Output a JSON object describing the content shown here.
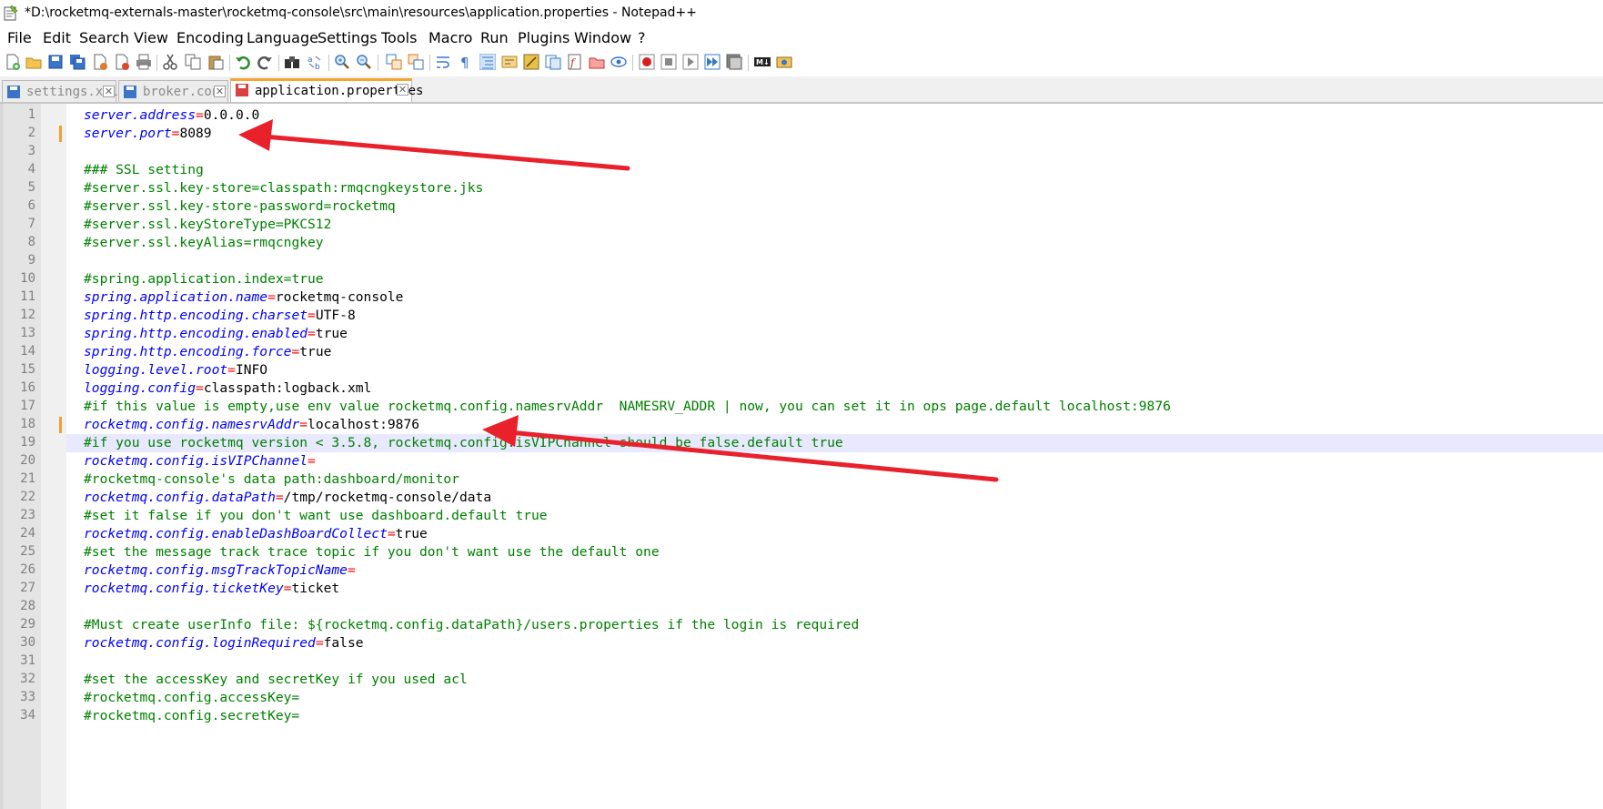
{
  "window": {
    "title": "*D:\\rocketmq-externals-master\\rocketmq-console\\src\\main\\resources\\application.properties - Notepad++"
  },
  "menu": [
    "File",
    "Edit",
    "Search",
    "View",
    "Encoding",
    "Language",
    "Settings",
    "Tools",
    "Macro",
    "Run",
    "Plugins",
    "Window",
    "?"
  ],
  "tabs": [
    {
      "label": "settings.xml",
      "active": false,
      "close": "✕"
    },
    {
      "label": "broker.conf",
      "active": false,
      "close": "✕"
    },
    {
      "label": "application.properties",
      "active": true,
      "close": "✕"
    }
  ],
  "editor": {
    "current_line": 19,
    "changed_lines": [
      2,
      18
    ],
    "lines": [
      {
        "n": "1",
        "type": "prop",
        "key": "server.address",
        "value": "0.0.0.0"
      },
      {
        "n": "2",
        "type": "prop",
        "key": "server.port",
        "value": "8089"
      },
      {
        "n": "3",
        "type": "blank"
      },
      {
        "n": "4",
        "type": "comment",
        "text": "### SSL setting"
      },
      {
        "n": "5",
        "type": "comment",
        "text": "#server.ssl.key-store=classpath:rmqcngkeystore.jks"
      },
      {
        "n": "6",
        "type": "comment",
        "text": "#server.ssl.key-store-password=rocketmq"
      },
      {
        "n": "7",
        "type": "comment",
        "text": "#server.ssl.keyStoreType=PKCS12"
      },
      {
        "n": "8",
        "type": "comment",
        "text": "#server.ssl.keyAlias=rmqcngkey"
      },
      {
        "n": "9",
        "type": "blank"
      },
      {
        "n": "10",
        "type": "comment",
        "text": "#spring.application.index=true"
      },
      {
        "n": "11",
        "type": "prop",
        "key": "spring.application.name",
        "value": "rocketmq-console"
      },
      {
        "n": "12",
        "type": "prop",
        "key": "spring.http.encoding.charset",
        "value": "UTF-8"
      },
      {
        "n": "13",
        "type": "prop",
        "key": "spring.http.encoding.enabled",
        "value": "true"
      },
      {
        "n": "14",
        "type": "prop",
        "key": "spring.http.encoding.force",
        "value": "true"
      },
      {
        "n": "15",
        "type": "prop",
        "key": "logging.level.root",
        "value": "INFO"
      },
      {
        "n": "16",
        "type": "prop",
        "key": "logging.config",
        "value": "classpath:logback.xml"
      },
      {
        "n": "17",
        "type": "comment",
        "text": "#if this value is empty,use env value rocketmq.config.namesrvAddr  NAMESRV_ADDR | now, you can set it in ops page.default localhost:9876"
      },
      {
        "n": "18",
        "type": "prop",
        "key": "rocketmq.config.namesrvAddr",
        "value": "localhost:9876"
      },
      {
        "n": "19",
        "type": "comment",
        "text": "#if you use rocketmq version < 3.5.8, rocketmq.config.isVIPChannel should be false.default true"
      },
      {
        "n": "20",
        "type": "prop",
        "key": "rocketmq.config.isVIPChannel",
        "value": ""
      },
      {
        "n": "21",
        "type": "comment",
        "text": "#rocketmq-console's data path:dashboard/monitor"
      },
      {
        "n": "22",
        "type": "prop",
        "key": "rocketmq.config.dataPath",
        "value": "/tmp/rocketmq-console/data"
      },
      {
        "n": "23",
        "type": "comment",
        "text": "#set it false if you don't want use dashboard.default true"
      },
      {
        "n": "24",
        "type": "prop",
        "key": "rocketmq.config.enableDashBoardCollect",
        "value": "true"
      },
      {
        "n": "25",
        "type": "comment",
        "text": "#set the message track trace topic if you don't want use the default one"
      },
      {
        "n": "26",
        "type": "prop",
        "key": "rocketmq.config.msgTrackTopicName",
        "value": ""
      },
      {
        "n": "27",
        "type": "prop",
        "key": "rocketmq.config.ticketKey",
        "value": "ticket"
      },
      {
        "n": "28",
        "type": "blank"
      },
      {
        "n": "29",
        "type": "comment",
        "text": "#Must create userInfo file: ${rocketmq.config.dataPath}/users.properties if the login is required"
      },
      {
        "n": "30",
        "type": "prop",
        "key": "rocketmq.config.loginRequired",
        "value": "false"
      },
      {
        "n": "31",
        "type": "blank"
      },
      {
        "n": "32",
        "type": "comment",
        "text": "#set the accessKey and secretKey if you used acl"
      },
      {
        "n": "33",
        "type": "comment",
        "text": "#rocketmq.config.accessKey="
      },
      {
        "n": "34",
        "type": "comment",
        "text": "#rocketmq.config.secretKey="
      }
    ]
  },
  "toolbar_icons": [
    "new-file-icon",
    "open-file-icon",
    "save-icon",
    "save-all-icon",
    "close-icon",
    "close-all-icon",
    "print-icon",
    "cut-icon",
    "copy-icon",
    "paste-icon",
    "undo-icon",
    "redo-icon",
    "find-icon",
    "replace-icon",
    "zoom-in-icon",
    "zoom-out-icon",
    "sync-vertical-icon",
    "sync-horizontal-icon",
    "word-wrap-icon",
    "show-all-chars-icon",
    "indent-guide-icon",
    "doc-map-icon",
    "function-list-icon",
    "folder-as-workspace-icon",
    "doc-list-icon",
    "monitor-icon",
    "record-macro-icon",
    "stop-macro-icon",
    "play-macro-icon",
    "play-macro-multiple-icon",
    "save-macro-icon",
    "markdown-icon",
    "plugin-icon"
  ],
  "colors": {
    "key": "#0000ff",
    "operator": "#ff0000",
    "comment": "#008000",
    "annotation_arrow": "#e8212b",
    "tab_accent": "#f7a531"
  }
}
